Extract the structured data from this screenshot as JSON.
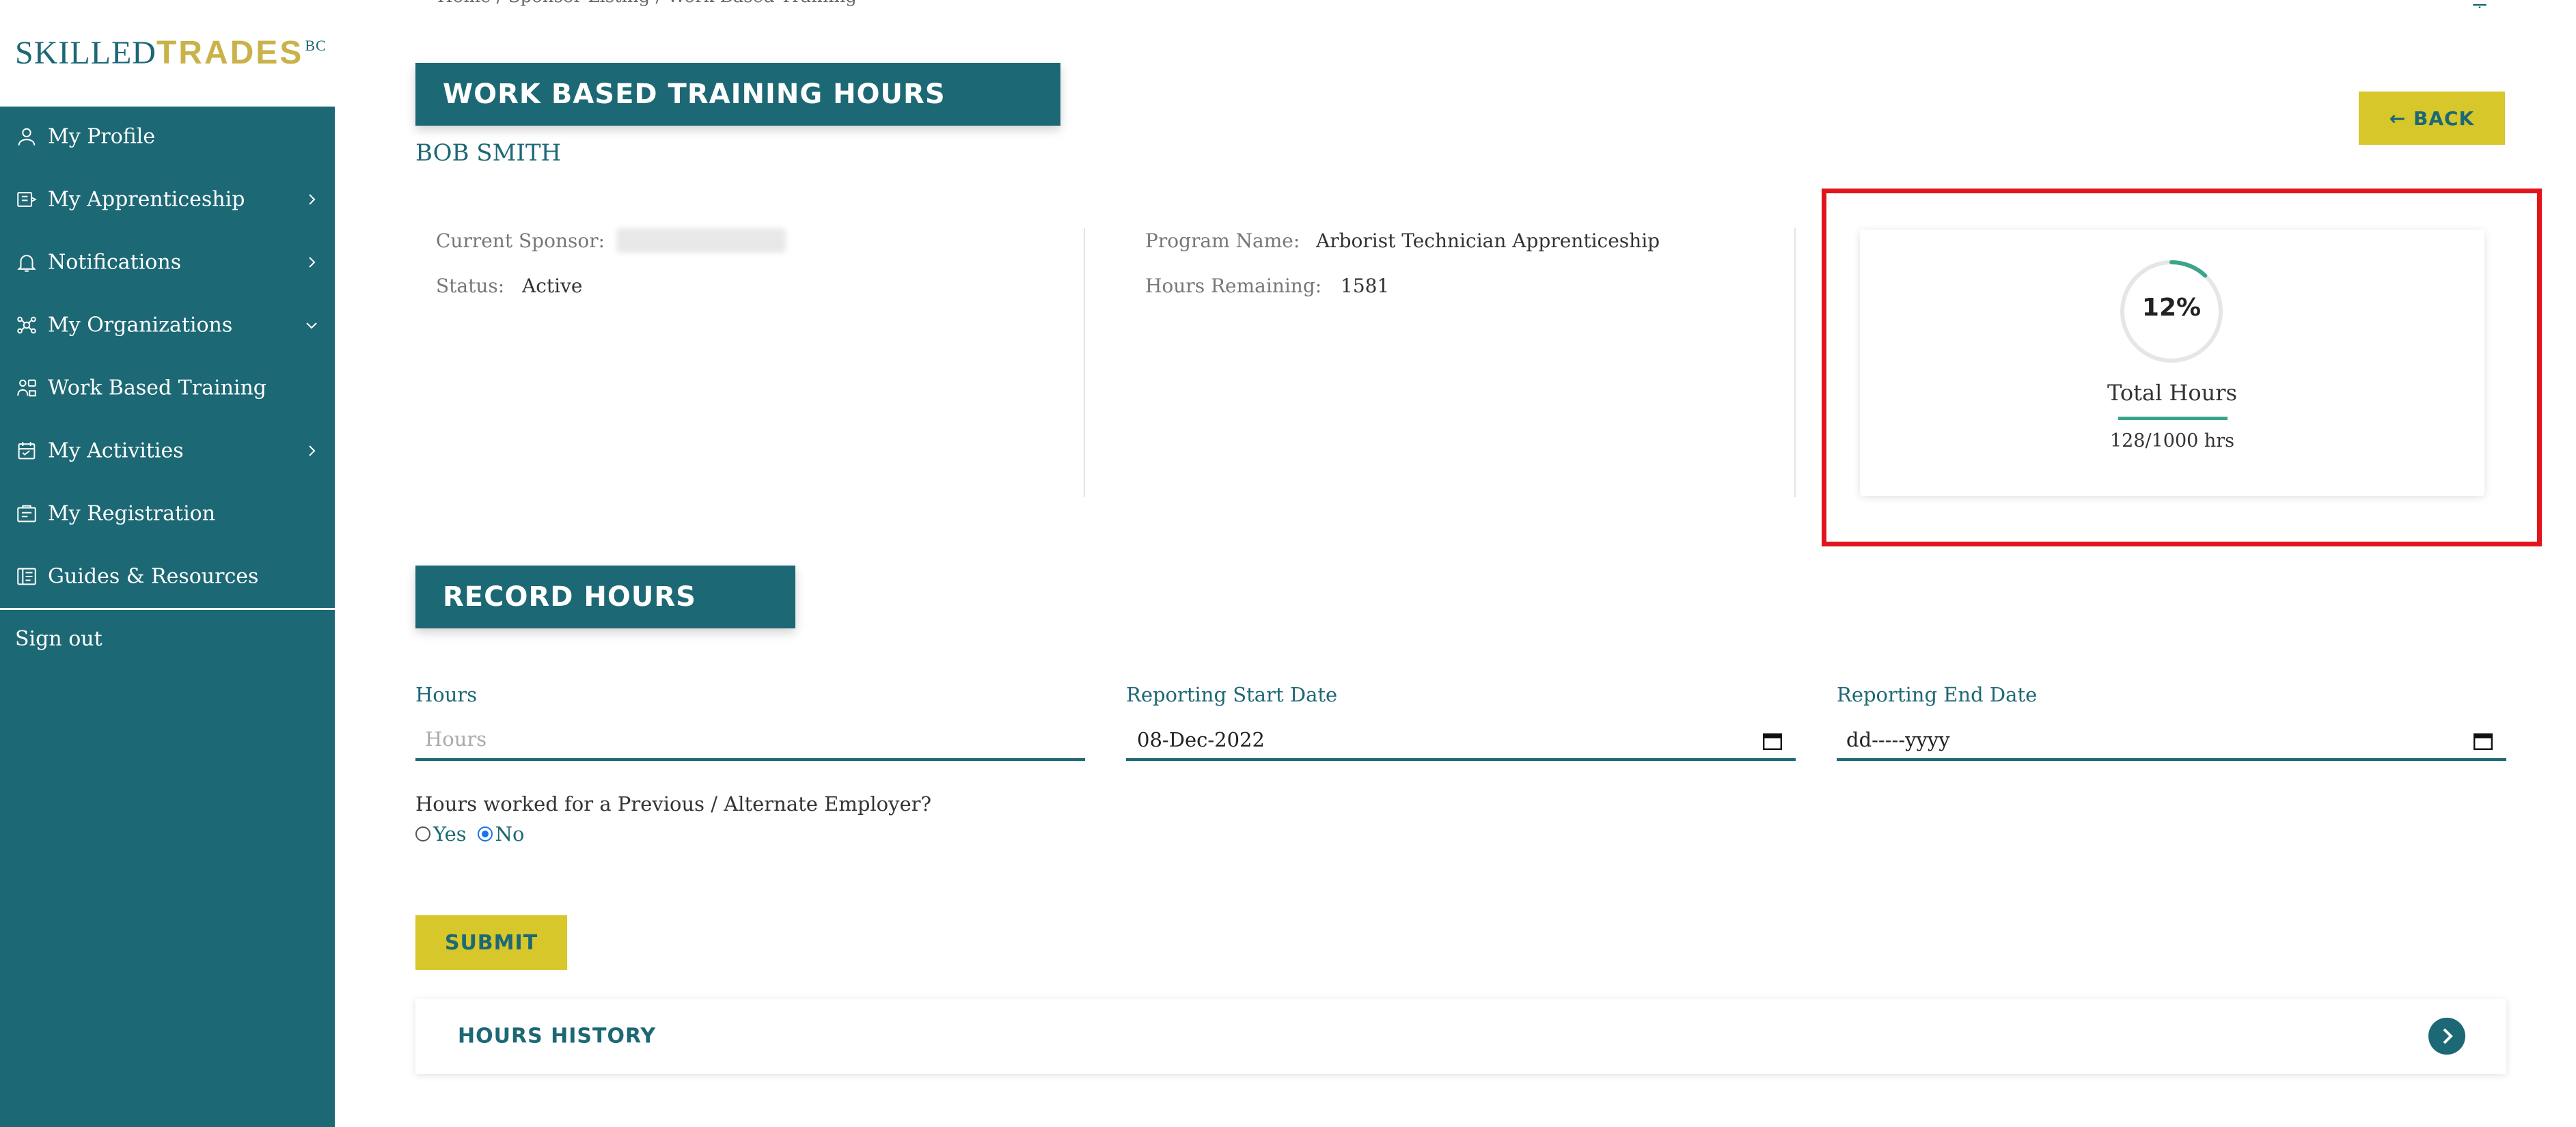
{
  "logo": {
    "part1": "SKILLED",
    "part2": "TRADES",
    "part3": "BC"
  },
  "sidebar": {
    "items": [
      {
        "label": "My Profile",
        "icon": "user-icon",
        "chevron": false
      },
      {
        "label": "My Apprenticeship",
        "icon": "apprenticeship-icon",
        "chevron": "right"
      },
      {
        "label": "Notifications",
        "icon": "bell-icon",
        "chevron": "right"
      },
      {
        "label": "My Organizations",
        "icon": "organizations-icon",
        "chevron": "down"
      },
      {
        "label": "Work Based Training",
        "icon": "training-icon",
        "chevron": false
      },
      {
        "label": "My Activities",
        "icon": "activities-icon",
        "chevron": "right"
      },
      {
        "label": "My Registration",
        "icon": "registration-icon",
        "chevron": false
      },
      {
        "label": "Guides & Resources",
        "icon": "guides-icon",
        "chevron": false
      }
    ],
    "signout": "Sign out"
  },
  "breadcrumb": "Home  /  Sponsor Listing  /  Work Based Training",
  "header": {
    "title": "WORK BASED TRAINING HOURS",
    "name": "BOB SMITH",
    "back_label": "← BACK"
  },
  "info": {
    "sponsor_label": "Current Sponsor:",
    "status_label": "Status:",
    "status_value": "Active",
    "program_label": "Program Name:",
    "program_value": "Arborist Technician Apprenticeship",
    "remaining_label": "Hours Remaining:",
    "remaining_value": "1581"
  },
  "progress": {
    "percent_text": "12%",
    "percent": 12,
    "label": "Total Hours",
    "hours_text": "128/1000 hrs"
  },
  "record": {
    "title": "RECORD HOURS",
    "hours_label": "Hours",
    "hours_placeholder": "Hours",
    "start_label": "Reporting Start Date",
    "start_value": "08-Dec-2022",
    "end_label": "Reporting End Date",
    "end_value": "dd-----yyyy",
    "question": "Hours worked for a Previous / Alternate Employer?",
    "yes_label": "Yes",
    "no_label": "No",
    "selected": "No",
    "submit_label": "SUBMIT"
  },
  "history": {
    "label": "HOURS HISTORY"
  },
  "colors": {
    "primary": "#1d6875",
    "accent": "#d7c72a",
    "progress": "#3aa58a",
    "highlight": "#e3151c"
  }
}
